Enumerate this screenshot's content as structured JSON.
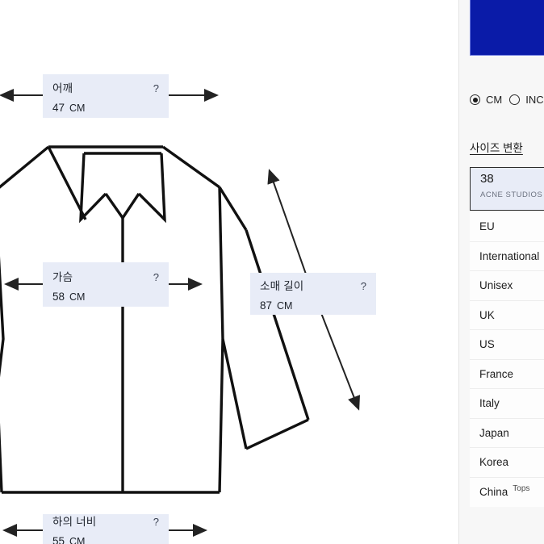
{
  "diagram": {
    "title": "garment-measurement-diagram",
    "help_symbol": "?",
    "unit_suffix": "CM",
    "measurements": [
      {
        "id": "shoulder",
        "label": "어깨",
        "value": "47",
        "unit": "CM",
        "help": "?"
      },
      {
        "id": "chest",
        "label": "가슴",
        "value": "58",
        "unit": "CM",
        "help": "?"
      },
      {
        "id": "sleeve",
        "label": "소매 길이",
        "value": "87",
        "unit": "CM",
        "help": "?"
      },
      {
        "id": "bottom",
        "label": "하의 너비",
        "value": "55",
        "unit": "CM",
        "help": "?"
      }
    ]
  },
  "sidebar": {
    "units": [
      {
        "label": "CM",
        "selected": true
      },
      {
        "label": "INCH",
        "selected": false
      }
    ],
    "convert_title": "사이즈 변환",
    "selected_size": {
      "size": "38",
      "brand": "ACNE STUDIOS"
    },
    "regions": [
      {
        "name": "EU",
        "sup": ""
      },
      {
        "name": "International",
        "sup": ""
      },
      {
        "name": "Unisex",
        "sup": ""
      },
      {
        "name": "UK",
        "sup": ""
      },
      {
        "name": "US",
        "sup": ""
      },
      {
        "name": "France",
        "sup": ""
      },
      {
        "name": "Italy",
        "sup": ""
      },
      {
        "name": "Japan",
        "sup": ""
      },
      {
        "name": "Korea",
        "sup": ""
      },
      {
        "name": "China",
        "sup": "Tops"
      }
    ]
  },
  "colors": {
    "brand_blue": "#0a1ba8",
    "box_fill": "#e8ecf7",
    "outline": "#111111"
  }
}
